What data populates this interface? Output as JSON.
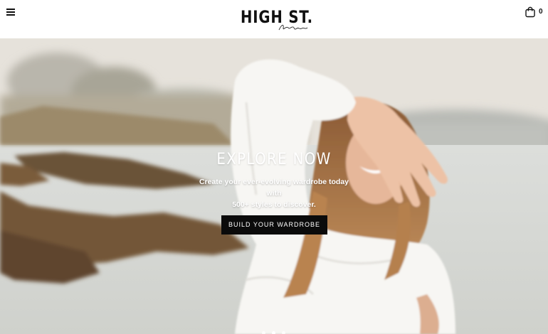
{
  "header": {
    "menu_icon": "hamburger-menu-icon",
    "logo": {
      "text": "HIGH ST.",
      "script_text": "here"
    },
    "cart": {
      "icon": "shopping-bag-icon",
      "count": "0"
    }
  },
  "hero": {
    "title": "EXPLORE NOW",
    "subtitle_line1": "Create your ever-evolving wardrobe today with",
    "subtitle_line2": "500+ styles to discover.",
    "button_label": "BUILD YOUR WARDROBE",
    "slide_count": 3,
    "active_slide": 1
  },
  "colors": {
    "button_bg": "#0b0b0b",
    "header_bg": "#ffffff",
    "hero_text": "#ffffff"
  }
}
